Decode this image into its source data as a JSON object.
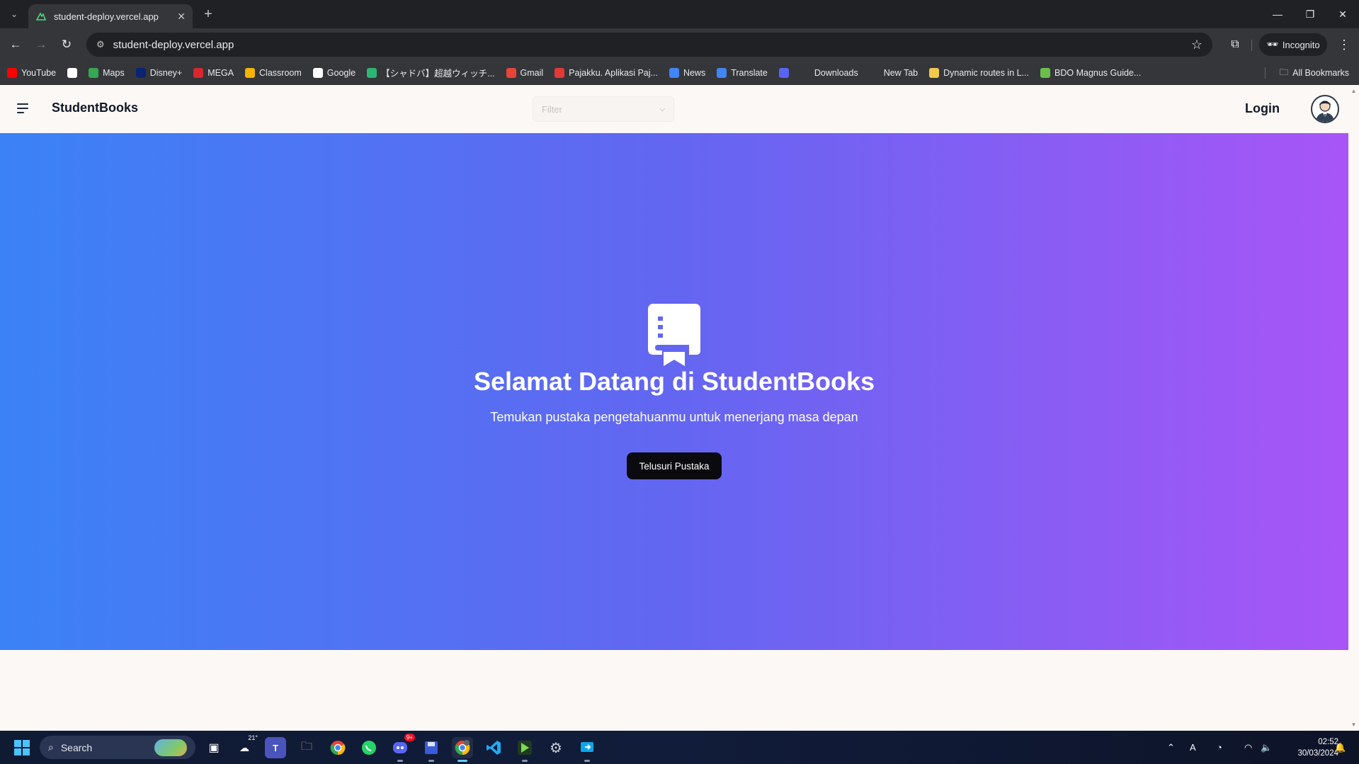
{
  "browser": {
    "tab_title": "student-deploy.vercel.app",
    "url": "student-deploy.vercel.app",
    "incognito_label": "Incognito",
    "bookmarks": [
      {
        "label": "YouTube",
        "icon": "youtube-icon",
        "color": "#ff0000"
      },
      {
        "label": "",
        "icon": "google-icon",
        "color": "#ffffff"
      },
      {
        "label": "Maps",
        "icon": "maps-icon",
        "color": "#34a853"
      },
      {
        "label": "Disney+",
        "icon": "disney-icon",
        "color": "#0a2472"
      },
      {
        "label": "MEGA",
        "icon": "mega-icon",
        "color": "#d9272e"
      },
      {
        "label": "Classroom",
        "icon": "classroom-icon",
        "color": "#f4b400"
      },
      {
        "label": "Google",
        "icon": "google-icon",
        "color": "#ffffff"
      },
      {
        "label": "【シャドバ】超越ウィッチ...",
        "icon": "game-icon",
        "color": "#2bb673"
      },
      {
        "label": "Gmail",
        "icon": "gmail-icon",
        "color": "#ea4335"
      },
      {
        "label": "Pajakku. Aplikasi Paj...",
        "icon": "pajakku-icon",
        "color": "#e53935"
      },
      {
        "label": "News",
        "icon": "news-icon",
        "color": "#4285f4"
      },
      {
        "label": "Translate",
        "icon": "translate-icon",
        "color": "#4285f4"
      },
      {
        "label": "",
        "icon": "discord-icon",
        "color": "#5865f2"
      },
      {
        "label": "Downloads",
        "icon": "download-icon",
        "color": "#35363a"
      },
      {
        "label": "New Tab",
        "icon": "globe-icon",
        "color": "#35363a"
      },
      {
        "label": "Dynamic routes in L...",
        "icon": "laravel-icon",
        "color": "#f2c94c"
      },
      {
        "label": "BDO Magnus Guide...",
        "icon": "bdo-icon",
        "color": "#6abf4b"
      }
    ],
    "all_bookmarks_label": "All Bookmarks"
  },
  "site": {
    "brand": "StudentBooks",
    "filter_placeholder": "Filter",
    "login_label": "Login"
  },
  "hero": {
    "title": "Selamat Datang di StudentBooks",
    "subtitle": "Temukan pustaka pengetahuanmu untuk menerjang masa depan",
    "cta_label": "Telusuri Pustaka",
    "gradient": [
      "#3b82f6",
      "#6366f1",
      "#a855f7"
    ]
  },
  "taskbar": {
    "search_label": "Search",
    "weather_temp": "21°",
    "discord_badge": "9+",
    "time": "02:52",
    "date": "30/03/2024"
  }
}
